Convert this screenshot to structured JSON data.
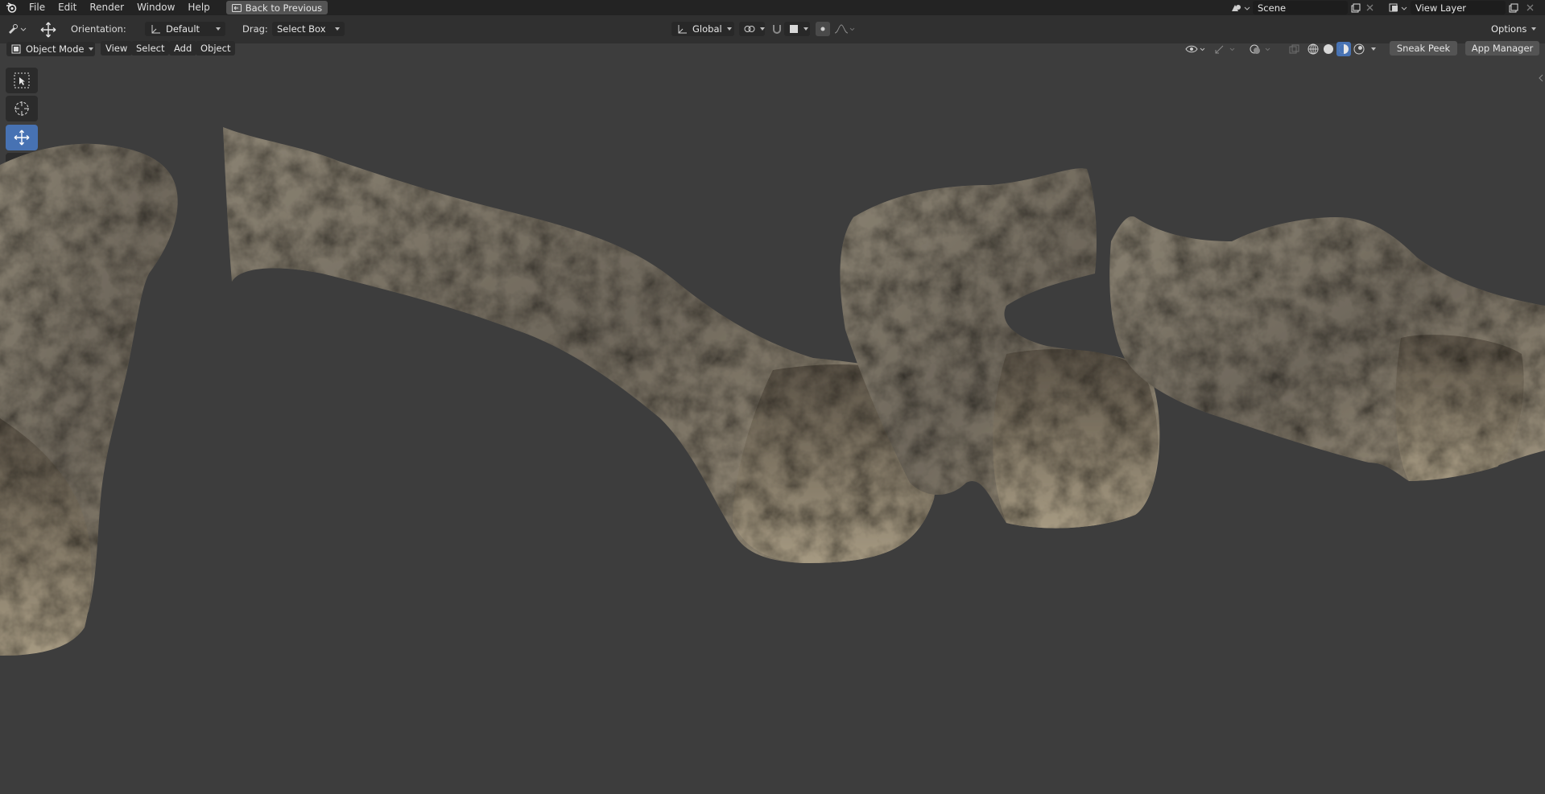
{
  "menu": {
    "file": "File",
    "edit": "Edit",
    "render": "Render",
    "window": "Window",
    "help": "Help",
    "back_to_previous": "Back to Previous"
  },
  "scene": {
    "name": "Scene"
  },
  "view_layer": {
    "name": "View Layer"
  },
  "tool_header": {
    "orientation_label": "Orientation:",
    "orientation_value": "Default",
    "drag_label": "Drag:",
    "drag_value": "Select Box",
    "transform_orientation": "Global",
    "options": "Options"
  },
  "viewport_header": {
    "mode": "Object Mode",
    "view": "View",
    "select": "Select",
    "add": "Add",
    "object": "Object",
    "sneak_peek": "Sneak Peek",
    "app_manager": "App Manager"
  },
  "colors": {
    "accent": "#4772b3",
    "viewport_bg": "#3d3d3d",
    "topbar_bg": "#232323"
  }
}
